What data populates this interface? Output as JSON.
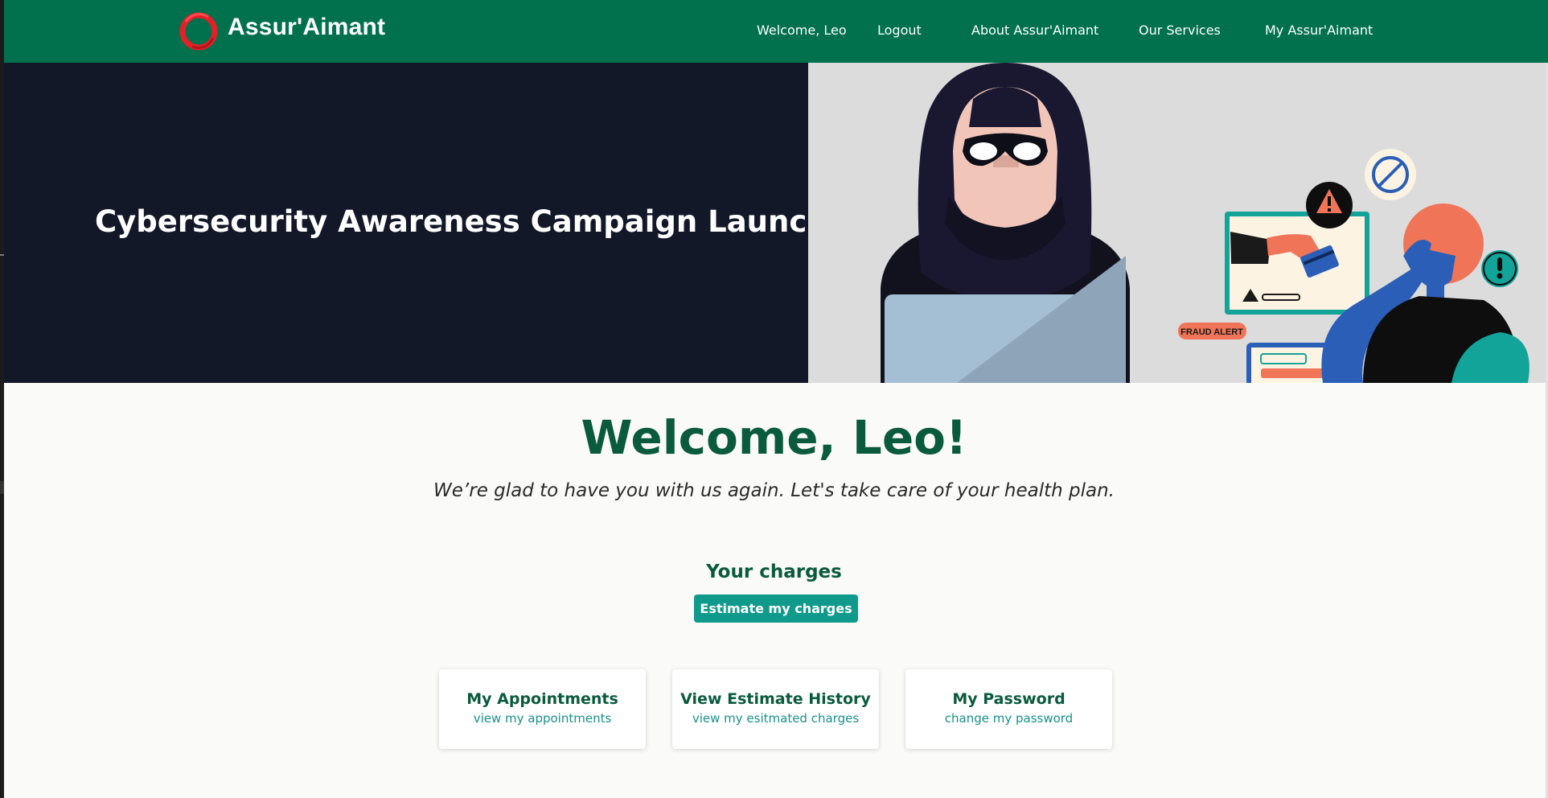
{
  "header": {
    "brand": "Assur'Aimant",
    "nav": {
      "welcome": "Welcome, Leo",
      "logout": "Logout",
      "about": "About Assur'Aimant",
      "services": "Our Services",
      "my_account": "My Assur'Aimant"
    }
  },
  "hero": {
    "title": "Cybersecurity Awareness Campaign Launched",
    "illustration": {
      "badge_label": "FRAUD ALERT",
      "icons": [
        "hacker-figure",
        "warning-icon",
        "prohibited-icon",
        "exclamation-icon",
        "credit-card-icon"
      ]
    }
  },
  "main": {
    "welcome_title": "Welcome, Leo!",
    "subtitle": "We’re glad to have you with us again. Let's take care of your health plan.",
    "charges": {
      "heading": "Your charges",
      "button_label": "Estimate my charges"
    },
    "cards": [
      {
        "title": "My Appointments",
        "link": "view my appointments"
      },
      {
        "title": "View Estimate History",
        "link": "view my esitmated charges"
      },
      {
        "title": "My Password",
        "link": "change my password"
      }
    ]
  },
  "colors": {
    "navbar": "#01714d",
    "hero_dark": "#131829",
    "heading_green": "#0a5a3e",
    "button_teal": "#109a8b",
    "link_teal": "#17918a",
    "logo_red": "#e32027"
  }
}
